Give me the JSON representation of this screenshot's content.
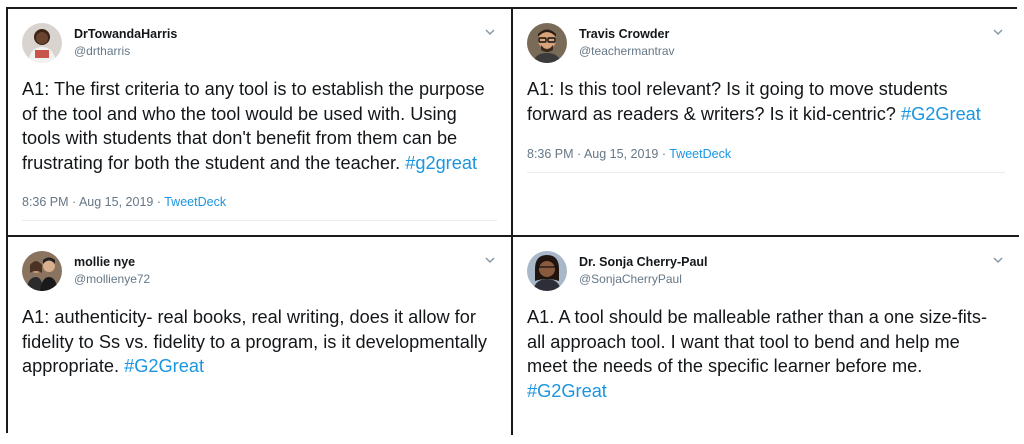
{
  "tweets": [
    {
      "name": "DrTowandaHarris",
      "handle": "@drtharris",
      "text": "A1: The first criteria to any tool is to establish the purpose of the tool and who the tool would be used with. Using tools with students that don't benefit from them can be frustrating for both the student and the teacher.",
      "hashtag": "#g2great",
      "time": "8:36 PM · Aug 15, 2019 ·",
      "source": "TweetDeck",
      "avatar_icon": "profile-photo",
      "menu_icon": "chevron-down-icon"
    },
    {
      "name": "Travis Crowder",
      "handle": "@teachermantrav",
      "text": "A1: Is this tool relevant? Is it going to move students forward as readers & writers? Is it kid-centric?",
      "hashtag": "#G2Great",
      "time": "8:36 PM · Aug 15, 2019 ·",
      "source": "TweetDeck",
      "avatar_icon": "profile-photo",
      "menu_icon": "chevron-down-icon"
    },
    {
      "name": "mollie nye",
      "handle": "@mollienye72",
      "text": "A1: authenticity- real books, real writing, does it allow for fidelity to Ss vs. fidelity to a program, is it developmentally appropriate.",
      "hashtag": "#G2Great",
      "avatar_icon": "profile-photo",
      "menu_icon": "chevron-down-icon"
    },
    {
      "name": "Dr. Sonja Cherry-Paul",
      "handle": "@SonjaCherryPaul",
      "text": "A1. A tool should be malleable rather than a one size-fits-all approach tool. I want that tool to bend and help me meet the needs of the specific learner before me.",
      "hashtag": "#G2Great",
      "avatar_icon": "profile-photo",
      "menu_icon": "chevron-down-icon"
    }
  ],
  "colors": {
    "link": "#1b95e0",
    "text": "#14171a",
    "muted": "#657786",
    "border": "#1a1a1a"
  }
}
